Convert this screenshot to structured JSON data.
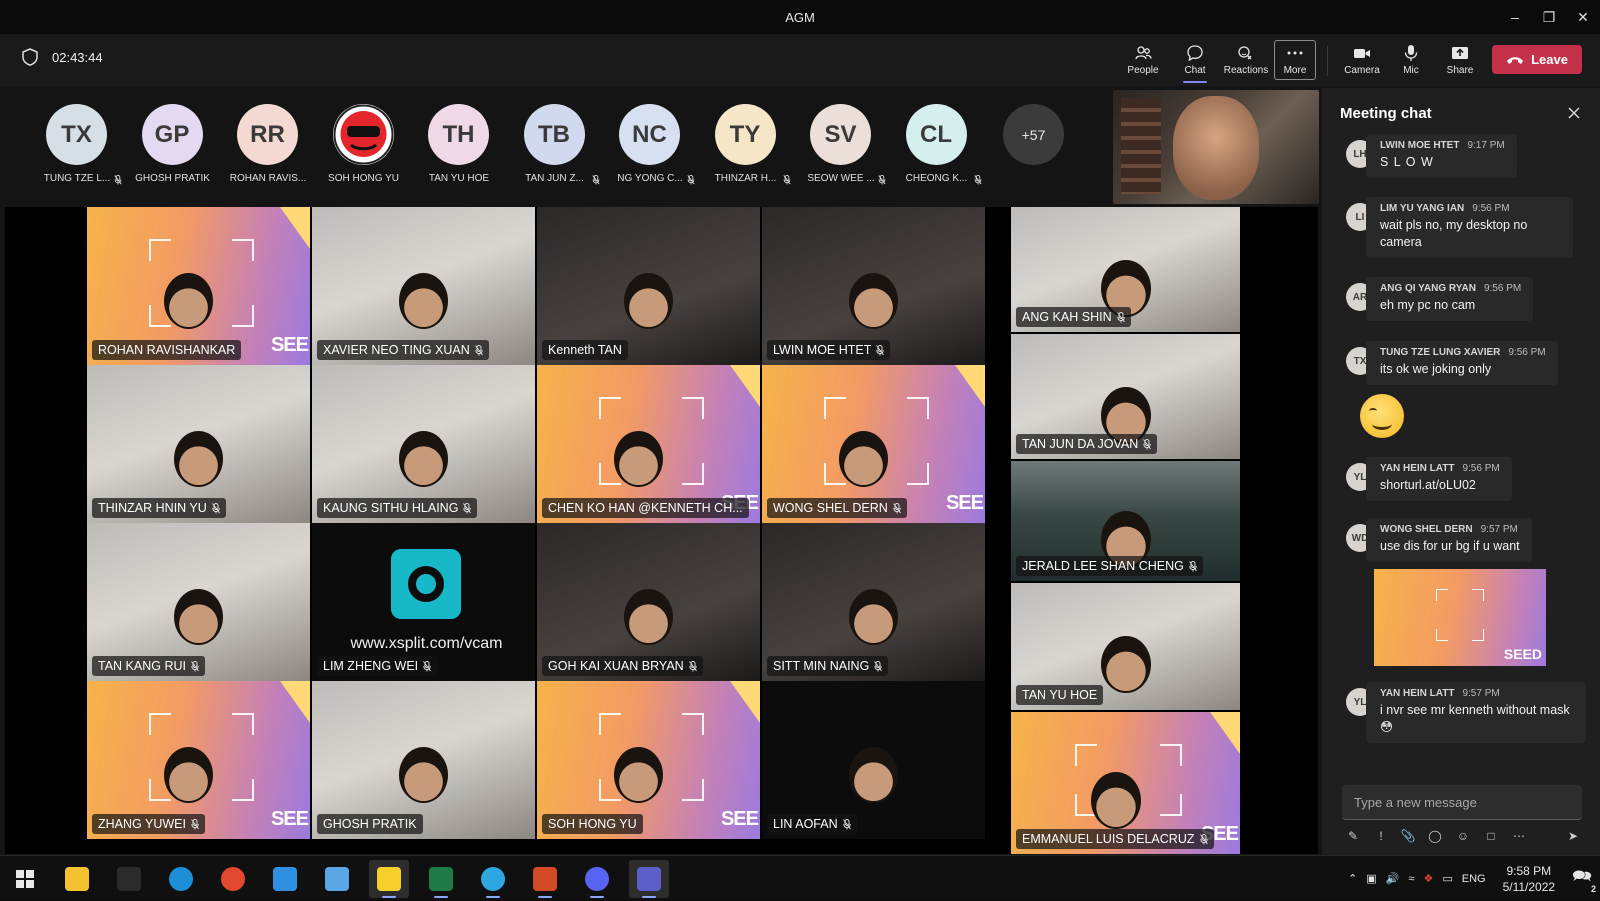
{
  "window": {
    "title": "AGM"
  },
  "toolbar": {
    "timer": "02:43:44",
    "buttons": [
      {
        "label": "People",
        "icon": "people-icon"
      },
      {
        "label": "Chat",
        "icon": "chat-icon"
      },
      {
        "label": "Reactions",
        "icon": "reactions-icon"
      },
      {
        "label": "More",
        "icon": "more-icon"
      },
      {
        "label": "Camera",
        "icon": "camera-icon"
      },
      {
        "label": "Mic",
        "icon": "mic-icon"
      },
      {
        "label": "Share",
        "icon": "share-icon"
      }
    ],
    "leave_label": "Leave",
    "leave_color": "#c4314b"
  },
  "roster": {
    "people": [
      {
        "initials": "TX",
        "name": "TUNG TZE L...",
        "color": "#d4e0e6",
        "muted": true
      },
      {
        "initials": "GP",
        "name": "GHOSH PRATIK",
        "color": "#e3d9f0",
        "muted": false
      },
      {
        "initials": "RR",
        "name": "ROHAN RAVIS...",
        "color": "#f3d9d1",
        "muted": false
      },
      {
        "initials": "",
        "name": "SOH HONG YU",
        "color": "#ffffff",
        "muted": false
      },
      {
        "initials": "TH",
        "name": "TAN YU HOE",
        "color": "#f0d9e6",
        "muted": false
      },
      {
        "initials": "TB",
        "name": "TAN JUN Z...",
        "color": "#d1d9ef",
        "muted": true
      },
      {
        "initials": "NC",
        "name": "NG YONG C...",
        "color": "#d6e0f0",
        "muted": true
      },
      {
        "initials": "TY",
        "name": "THINZAR H...",
        "color": "#f5e6c8",
        "muted": true
      },
      {
        "initials": "SV",
        "name": "SEOW WEE ...",
        "color": "#ecdfd9",
        "muted": true
      },
      {
        "initials": "CL",
        "name": "CHEONG K...",
        "color": "#d5efef",
        "muted": true
      }
    ],
    "overflow": "+57"
  },
  "tiles": [
    {
      "name": "ROHAN RAVISHANKAR",
      "bg": "seed",
      "muted": false
    },
    {
      "name": "XAVIER NEO TING XUAN",
      "bg": "room",
      "muted": true
    },
    {
      "name": "Kenneth TAN",
      "bg": "dark",
      "muted": false
    },
    {
      "name": "LWIN MOE HTET",
      "bg": "dark",
      "muted": true
    },
    {
      "name": "ANG KAH SHIN",
      "bg": "room",
      "muted": true
    },
    {
      "name": "THINZAR HNIN YU",
      "bg": "room",
      "muted": true
    },
    {
      "name": "KAUNG SITHU HLAING",
      "bg": "room",
      "muted": true
    },
    {
      "name": "CHEN KO HAN @KENNETH CH...",
      "bg": "seed",
      "muted": false
    },
    {
      "name": "WONG SHEL DERN",
      "bg": "seed",
      "muted": true
    },
    {
      "name": "TAN JUN DA JOVAN",
      "bg": "room",
      "muted": true
    },
    {
      "name": "JERALD LEE SHAN CHENG",
      "bg": "office",
      "muted": true
    },
    {
      "name": "TAN KANG RUI",
      "bg": "room",
      "muted": true
    },
    {
      "name": "LIM ZHENG WEI",
      "bg": "xsplit",
      "muted": true,
      "url": "www.xsplit.com/vcam"
    },
    {
      "name": "GOH KAI XUAN BRYAN",
      "bg": "dark",
      "muted": true
    },
    {
      "name": "SITT MIN NAING",
      "bg": "dark",
      "muted": true
    },
    {
      "name": "TAN YU HOE",
      "bg": "room",
      "muted": false
    },
    {
      "name": "ZHANG YUWEI",
      "bg": "seed",
      "muted": true
    },
    {
      "name": "GHOSH PRATIK",
      "bg": "room",
      "muted": false
    },
    {
      "name": "SOH HONG YU",
      "bg": "seed",
      "muted": false
    },
    {
      "name": "LIN AOFAN",
      "bg": "black",
      "muted": true
    },
    {
      "name": "EMMANUEL LUIS DELACRUZ",
      "bg": "seed",
      "muted": true
    }
  ],
  "seed_text": "SEE",
  "chat": {
    "title": "Meeting chat",
    "messages": [
      {
        "initials": "LH",
        "sender": "LWIN MOE HTET",
        "time": "9:17 PM",
        "text": "S L O W"
      },
      {
        "initials": "LI",
        "sender": "LIM YU YANG IAN",
        "time": "9:56 PM",
        "text": "wait pls no, my desktop no camera"
      },
      {
        "initials": "AR",
        "sender": "ANG QI YANG RYAN",
        "time": "9:56 PM",
        "text": "eh my pc no cam"
      },
      {
        "initials": "TX",
        "sender": "TUNG TZE LUNG XAVIER",
        "time": "9:56 PM",
        "text": "its ok we joking only"
      },
      {
        "initials": "YL",
        "sender": "YAN HEIN LATT",
        "time": "9:56 PM",
        "text": "shorturl.at/oLU02"
      },
      {
        "initials": "WD",
        "sender": "WONG SHEL DERN",
        "time": "9:57 PM",
        "text": "use dis for ur bg if u want"
      },
      {
        "initials": "YL",
        "sender": "YAN HEIN LATT",
        "time": "9:57 PM",
        "text": "i nvr see mr kenneth without mask 😳"
      }
    ],
    "chat_image_seed": "SEED",
    "compose_placeholder": "Type a new message"
  },
  "taskbar": {
    "apps": [
      "start-icon",
      "file-explorer-icon",
      "terminal-icon",
      "edge-icon",
      "chrome-icon",
      "vscode-icon",
      "snipping-icon",
      "sticky-notes-icon",
      "excel-icon",
      "telegram-icon",
      "powerpoint-icon",
      "discord-icon",
      "teams-icon"
    ],
    "lang": "ENG",
    "time": "9:58 PM",
    "date": "5/11/2022",
    "notif_count": "2"
  }
}
